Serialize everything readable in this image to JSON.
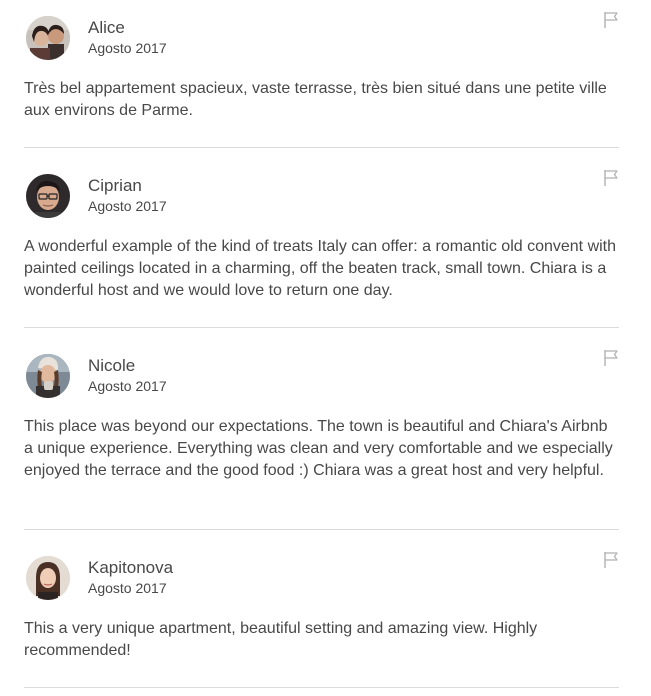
{
  "reviews": [
    {
      "name": "Alice",
      "date": "Agosto 2017",
      "text": "Très bel appartement spacieux, vaste terrasse, très bien situé dans une petite ville aux environs de Parme.",
      "flag_icon": "flag-icon"
    },
    {
      "name": "Ciprian",
      "date": "Agosto 2017",
      "text": "A wonderful example of the kind of treats Italy can offer: a romantic old convent with painted ceilings located in a charming, off the beaten track, small town. Chiara is a wonderful host and we would love to return one day.",
      "flag_icon": "flag-icon"
    },
    {
      "name": "Nicole",
      "date": "Agosto 2017",
      "text": "This place was beyond our expectations. The town is beautiful and Chiara's Airbnb a unique experience. Everything was clean and very comfortable and we especially enjoyed the terrace and the good food :) Chiara was a great host and very helpful.",
      "flag_icon": "flag-icon"
    },
    {
      "name": "Kapitonova",
      "date": "Agosto 2017",
      "text": "This a very unique apartment, beautiful setting and amazing view. Highly recommended!",
      "flag_icon": "flag-icon"
    }
  ],
  "colors": {
    "text": "#484848",
    "divider": "#dbdbdb",
    "flag": "#b0b0b0"
  }
}
